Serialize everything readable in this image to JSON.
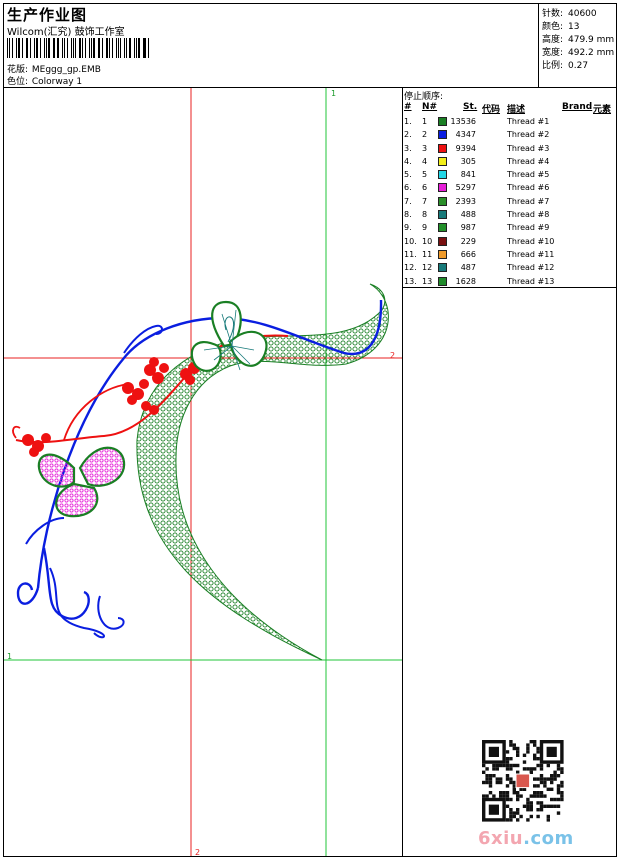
{
  "header": {
    "title": "生产作业图",
    "studio": "Wilcom(汇究) 鼓饰工作室",
    "fields": [
      {
        "label": "花版:",
        "value": "MEggg_gp.EMB"
      },
      {
        "label": "色位:",
        "value": "Colorway 1"
      }
    ]
  },
  "stats": [
    {
      "label": "针数:",
      "value": "40600"
    },
    {
      "label": "颜色:",
      "value": "13"
    },
    {
      "label": "高度:",
      "value": "479.9 mm"
    },
    {
      "label": "宽度:",
      "value": "492.2 mm"
    },
    {
      "label": "比例:",
      "value": "0.27"
    }
  ],
  "thread_panel": {
    "title": "停止顺序:",
    "columns": {
      "seq": "#",
      "needle": "N#",
      "stitches": "St.",
      "code": "代码",
      "desc": "描述",
      "brand": "Brand",
      "element": "元素"
    },
    "rows": [
      {
        "seq": "1.",
        "needle": "1",
        "color": "#1a7f24",
        "stitches": "13536",
        "desc": "Thread #1"
      },
      {
        "seq": "2.",
        "needle": "2",
        "color": "#0a1ee0",
        "stitches": "4347",
        "desc": "Thread #2"
      },
      {
        "seq": "3.",
        "needle": "3",
        "color": "#ee1111",
        "stitches": "9394",
        "desc": "Thread #3"
      },
      {
        "seq": "4.",
        "needle": "4",
        "color": "#f2ef1a",
        "stitches": "305",
        "desc": "Thread #4"
      },
      {
        "seq": "5.",
        "needle": "5",
        "color": "#22d6e6",
        "stitches": "841",
        "desc": "Thread #5"
      },
      {
        "seq": "6.",
        "needle": "6",
        "color": "#e61ed8",
        "stitches": "5297",
        "desc": "Thread #6"
      },
      {
        "seq": "7.",
        "needle": "7",
        "color": "#2a8f2a",
        "stitches": "2393",
        "desc": "Thread #7"
      },
      {
        "seq": "8.",
        "needle": "8",
        "color": "#177a7a",
        "stitches": "488",
        "desc": "Thread #8"
      },
      {
        "seq": "9.",
        "needle": "9",
        "color": "#22902a",
        "stitches": "987",
        "desc": "Thread #9"
      },
      {
        "seq": "10.",
        "needle": "10",
        "color": "#7a1010",
        "stitches": "229",
        "desc": "Thread #10"
      },
      {
        "seq": "11.",
        "needle": "11",
        "color": "#ef9a2a",
        "stitches": "666",
        "desc": "Thread #11"
      },
      {
        "seq": "12.",
        "needle": "12",
        "color": "#177a7a",
        "stitches": "487",
        "desc": "Thread #12"
      },
      {
        "seq": "13.",
        "needle": "13",
        "color": "#1f8a2a",
        "stitches": "1628",
        "desc": "Thread #13"
      }
    ]
  },
  "guides": {
    "v1": "1",
    "h2": "2",
    "v2": "2",
    "h1": "1"
  },
  "watermark": {
    "text_a": "6xiu",
    "text_b": ".com"
  }
}
